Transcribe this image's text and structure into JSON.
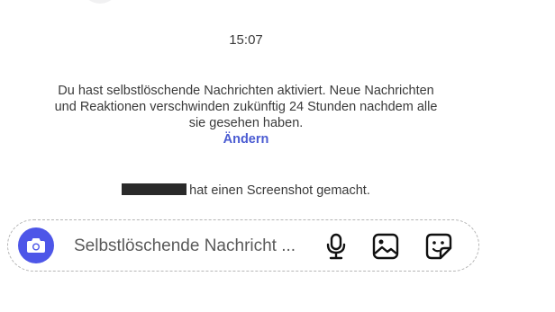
{
  "conversation": {
    "timestamp": "15:07",
    "disappearing_notice": {
      "text": "Du hast selbstlöschende Nachrichten aktiviert. Neue Nachrichten und Reaktionen verschwinden zukünftig 24 Stunden nachdem alle sie gesehen haben.",
      "link_label": "Ändern"
    },
    "screenshot_event": {
      "text": "hat einen Screenshot gemacht."
    }
  },
  "composer": {
    "placeholder": "Selbstlöschende Nachricht ...",
    "icons": {
      "camera": "camera-icon",
      "microphone": "microphone-icon",
      "gallery": "image-gallery-icon",
      "sticker": "sticker-icon"
    }
  },
  "colors": {
    "accent": "#4d56e8",
    "link": "#4a5bd2",
    "text": "#3a3a3a",
    "redaction": "#2a2a2a"
  }
}
